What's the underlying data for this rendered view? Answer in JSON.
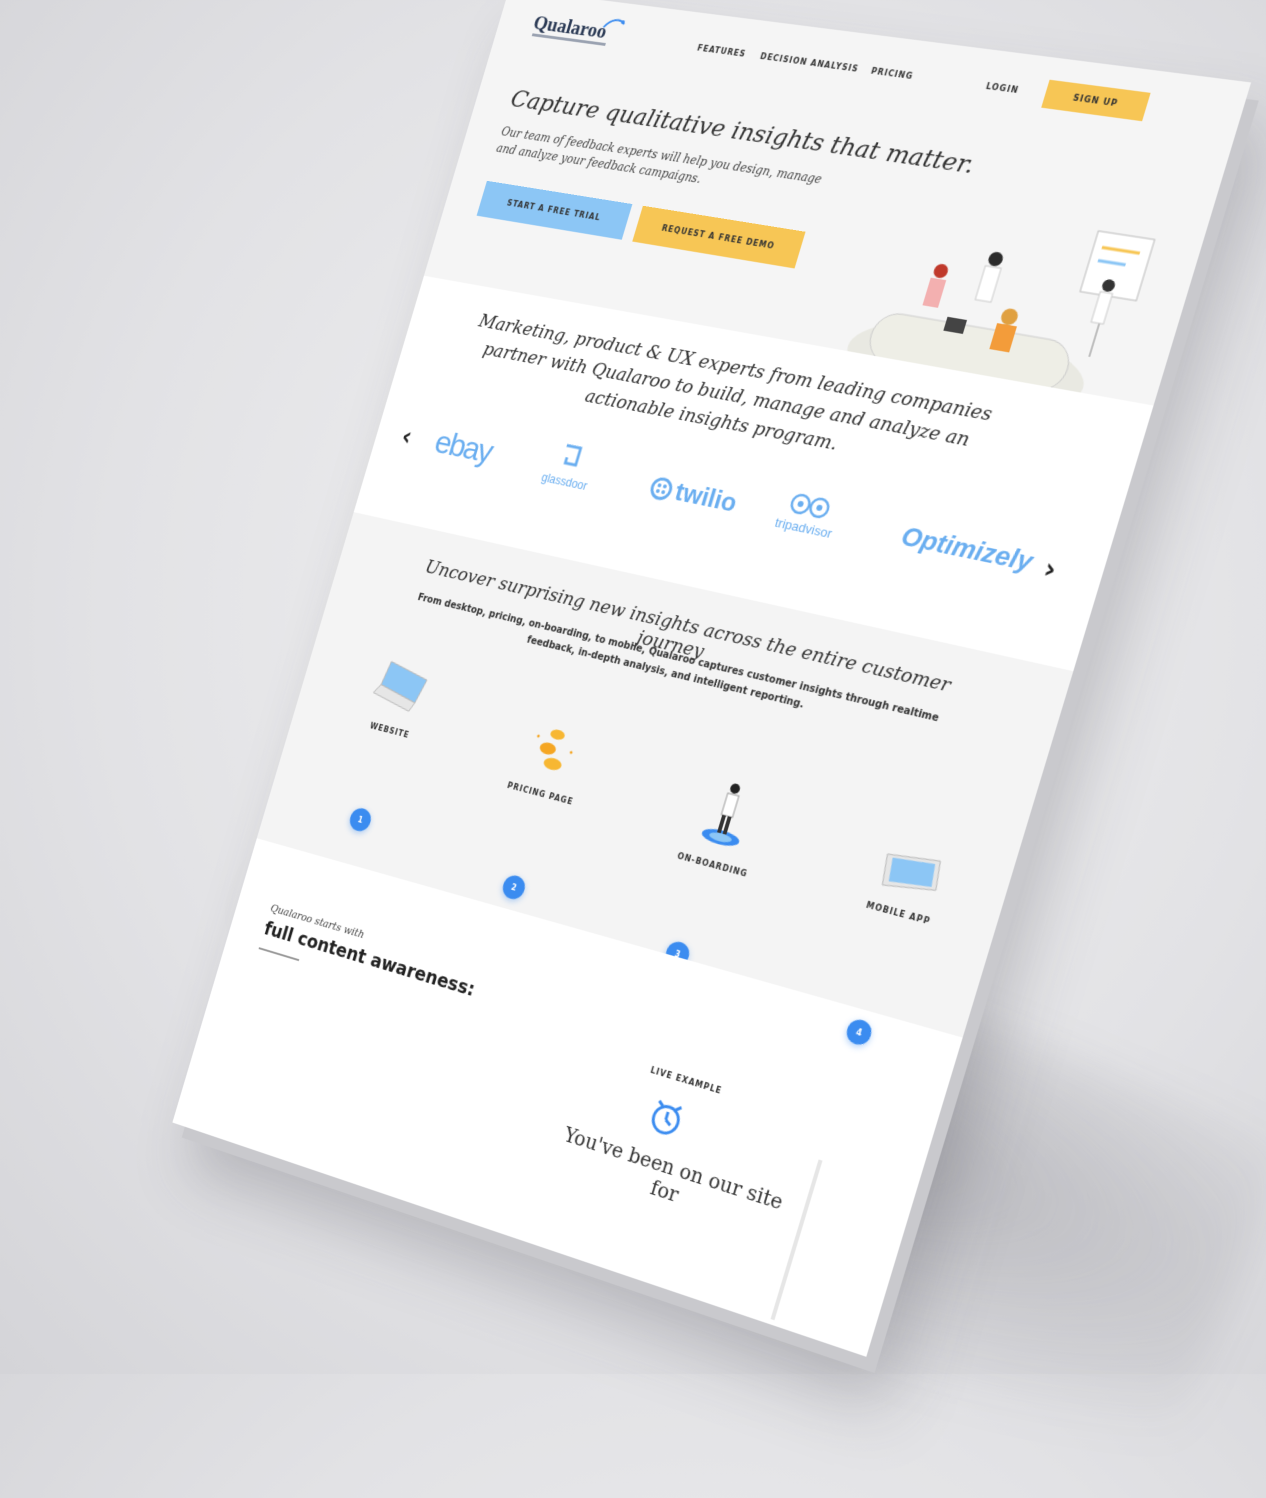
{
  "nav": {
    "logo": "Qualaroo",
    "links": [
      "FEATURES",
      "DECISION ANALYSIS",
      "PRICING"
    ],
    "login": "LOGIN",
    "signup": "SIGN UP"
  },
  "hero": {
    "title": "Capture qualitative insights that matter.",
    "subtitle": "Our team of feedback experts will help you design, manage and analyze your feedback campaigns.",
    "cta_primary": "START A FREE TRIAL",
    "cta_secondary": "REQUEST A FREE DEMO"
  },
  "partners": {
    "title": "Marketing, product & UX experts from leading companies partner with Qualaroo to build, manage and analyze an actionable insights program.",
    "logos": [
      "ebay",
      "glassdoor",
      "twilio",
      "tripadvisor",
      "Optimizely"
    ],
    "prev": "‹",
    "next": "›"
  },
  "journey": {
    "title": "Uncover surprising new insights across the entire customer journey",
    "subtitle": "From desktop, pricing, on-boarding, to mobile, Qualaroo captures customer insights through realtime feedback, in-depth analysis, and intelligent reporting.",
    "steps": [
      {
        "label": "WEBSITE",
        "num": "1"
      },
      {
        "label": "PRICING PAGE",
        "num": "2"
      },
      {
        "label": "ON-BOARDING",
        "num": "3"
      },
      {
        "label": "MOBILE APP",
        "num": "4"
      }
    ]
  },
  "awareness": {
    "small": "Qualaroo starts with",
    "big": "full content awareness:",
    "live": "LIVE EXAMPLE",
    "been": "You've been on our site for"
  },
  "colors": {
    "yellow": "#f7c655",
    "blue": "#8cc6f5",
    "accent": "#3b8cf0",
    "logo_blue": "#6aaef0"
  }
}
